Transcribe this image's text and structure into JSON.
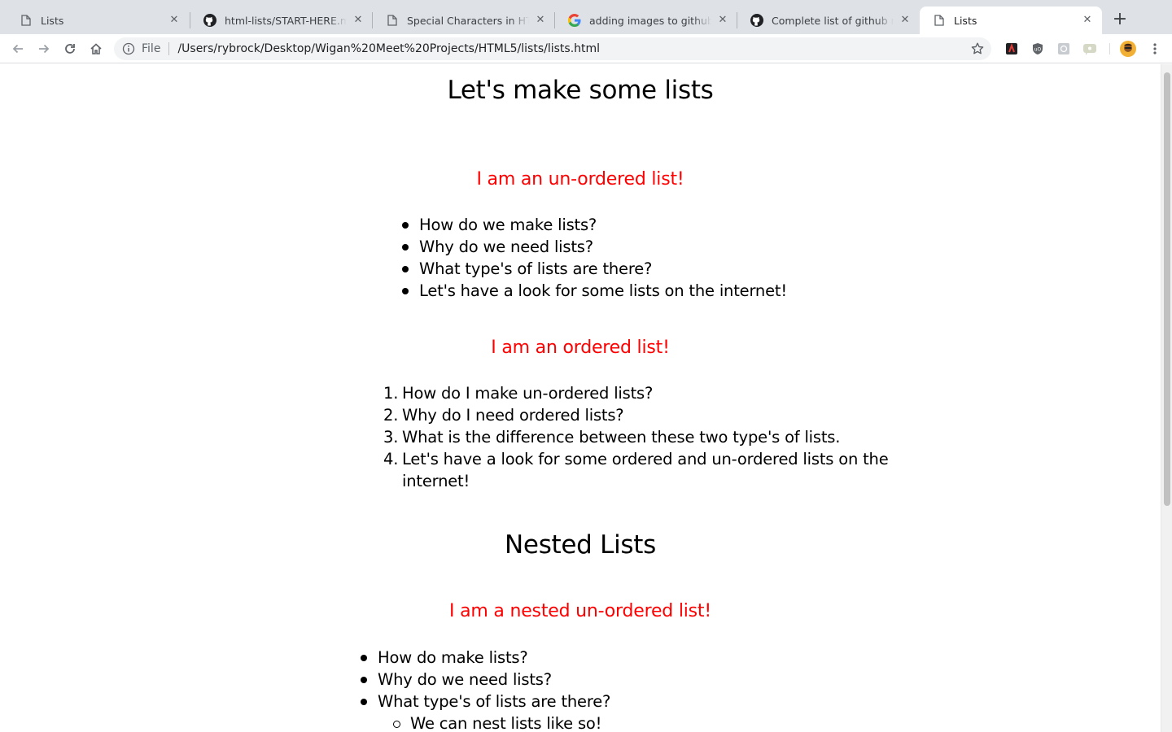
{
  "tabs": [
    {
      "title": "Lists",
      "icon": "page-icon"
    },
    {
      "title": "html-lists/START-HERE.md at master",
      "icon": "github-icon"
    },
    {
      "title": "Special Characters in HTML",
      "icon": "page-icon"
    },
    {
      "title": "adding images to github readme",
      "icon": "google-icon"
    },
    {
      "title": "Complete list of github markdown",
      "icon": "github-icon"
    },
    {
      "title": "Lists",
      "icon": "page-icon",
      "active": true
    }
  ],
  "toolbar": {
    "scheme": "File",
    "url": "/Users/rybrock/Desktop/Wigan%20Meet%20Projects/HTML5/lists/lists.html",
    "extensions": [
      "extension-red-icon",
      "ublock-icon",
      "extension-grid-icon",
      "extension-chat-icon"
    ]
  },
  "page": {
    "title": "Let's make some lists",
    "unordered_heading": "I am an un-ordered list!",
    "unordered_items": [
      "How do we make lists?",
      "Why do we need lists?",
      "What type's of lists are there?",
      "Let's have a look for some lists on the internet!"
    ],
    "ordered_heading": "I am an ordered list!",
    "ordered_items": [
      "How do I make un-ordered lists?",
      "Why do I need ordered lists?",
      "What is the difference between these two type's of lists.",
      "Let's have a look for some ordered and un-ordered lists on the internet!"
    ],
    "nested_title": "Nested Lists",
    "nested_heading": "I am a nested un-ordered list!",
    "nested_items": [
      "How do make lists?",
      "Why do we need lists?",
      "What type's of lists are there?"
    ],
    "nested_sub_items": [
      "We can nest lists like so!"
    ]
  },
  "colors": {
    "heading_red": "#ff0000",
    "tabstrip": "#dee1e6",
    "omnibox": "#f1f3f4"
  }
}
